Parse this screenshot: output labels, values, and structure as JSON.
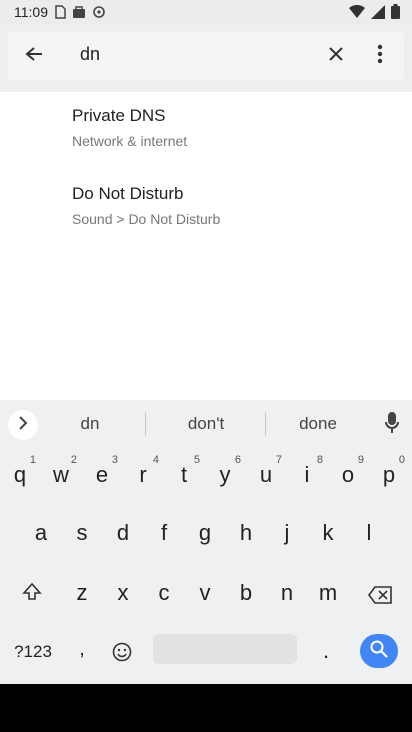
{
  "status": {
    "time": "11:09"
  },
  "search": {
    "query": "dn"
  },
  "results": [
    {
      "title": "Private DNS",
      "subtitle": "Network & internet"
    },
    {
      "title": "Do Not Disturb",
      "subtitle": "Sound > Do Not Disturb"
    }
  ],
  "keyboard": {
    "suggestions": [
      "dn",
      "don't",
      "done"
    ],
    "row1": [
      {
        "k": "q",
        "h": "1"
      },
      {
        "k": "w",
        "h": "2"
      },
      {
        "k": "e",
        "h": "3"
      },
      {
        "k": "r",
        "h": "4"
      },
      {
        "k": "t",
        "h": "5"
      },
      {
        "k": "y",
        "h": "6"
      },
      {
        "k": "u",
        "h": "7"
      },
      {
        "k": "i",
        "h": "8"
      },
      {
        "k": "o",
        "h": "9"
      },
      {
        "k": "p",
        "h": "0"
      }
    ],
    "row2": [
      "a",
      "s",
      "d",
      "f",
      "g",
      "h",
      "j",
      "k",
      "l"
    ],
    "row3": [
      "z",
      "x",
      "c",
      "v",
      "b",
      "n",
      "m"
    ],
    "symbols_label": "?123",
    "comma": ",",
    "period": "."
  },
  "colors": {
    "accent": "#4285f4",
    "keyboard_bg": "#eef0f2",
    "header_bg": "#eeeeee"
  }
}
